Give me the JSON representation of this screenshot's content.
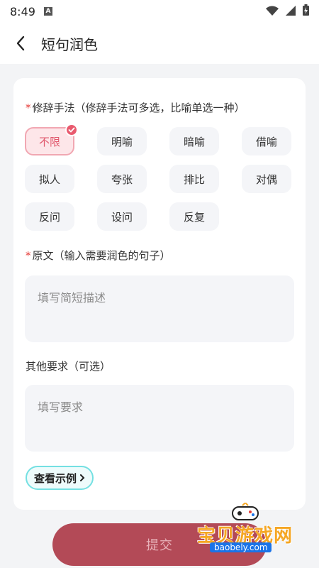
{
  "status": {
    "time": "8:49",
    "app_badge": "A"
  },
  "header": {
    "title": "短句润色"
  },
  "technique": {
    "required_mark": "*",
    "label": "修辞手法（修辞手法可多选，比喻单选一种）",
    "options": [
      {
        "label": "不限",
        "selected": true
      },
      {
        "label": "明喻",
        "selected": false
      },
      {
        "label": "暗喻",
        "selected": false
      },
      {
        "label": "借喻",
        "selected": false
      },
      {
        "label": "拟人",
        "selected": false
      },
      {
        "label": "夸张",
        "selected": false
      },
      {
        "label": "排比",
        "selected": false
      },
      {
        "label": "对偶",
        "selected": false
      },
      {
        "label": "反问",
        "selected": false
      },
      {
        "label": "设问",
        "selected": false
      },
      {
        "label": "反复",
        "selected": false
      }
    ]
  },
  "original": {
    "required_mark": "*",
    "label": "原文（输入需要润色的句子）",
    "placeholder": "填写简短描述"
  },
  "other": {
    "label": "其他要求（可选）",
    "placeholder": "填写要求"
  },
  "example_button": {
    "label": "查看示例"
  },
  "submit": {
    "label": "提交"
  },
  "watermark": {
    "text": "宝贝游戏网",
    "url": "baobely.com"
  }
}
